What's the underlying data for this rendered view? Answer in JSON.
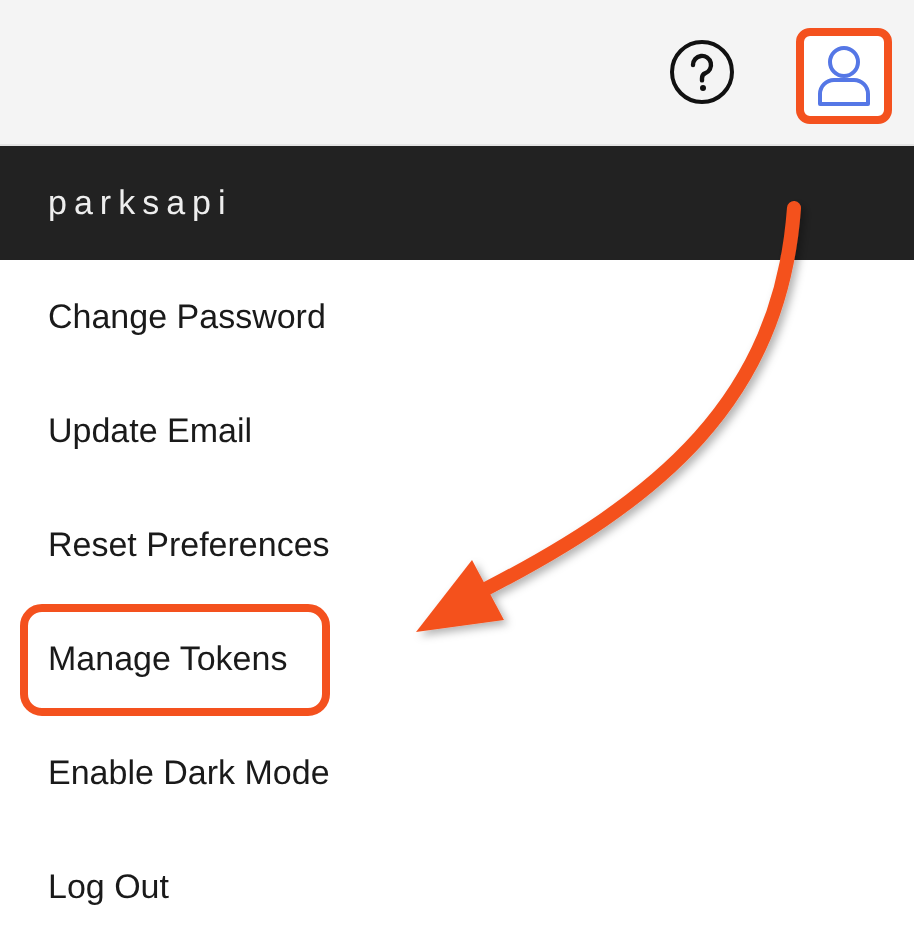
{
  "top_bar": {
    "user_button": {
      "highlighted": true
    }
  },
  "menu": {
    "username": "parksapi",
    "items": [
      {
        "label": "Change Password",
        "highlighted": false
      },
      {
        "label": "Update Email",
        "highlighted": false
      },
      {
        "label": "Reset Preferences",
        "highlighted": false
      },
      {
        "label": "Manage Tokens",
        "highlighted": true
      },
      {
        "label": "Enable Dark Mode",
        "highlighted": false
      },
      {
        "label": "Log Out",
        "highlighted": false
      }
    ]
  }
}
